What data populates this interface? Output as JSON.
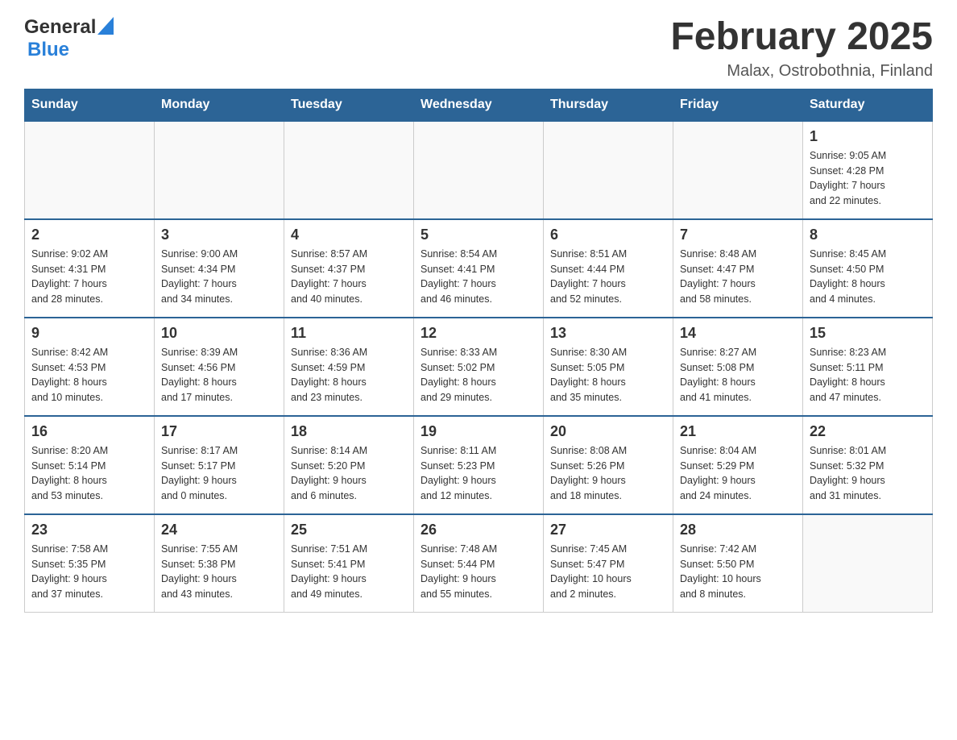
{
  "header": {
    "logo": {
      "general": "General",
      "blue": "Blue",
      "triangle": "▶"
    },
    "title": "February 2025",
    "location": "Malax, Ostrobothnia, Finland"
  },
  "weekdays": [
    "Sunday",
    "Monday",
    "Tuesday",
    "Wednesday",
    "Thursday",
    "Friday",
    "Saturday"
  ],
  "weeks": [
    [
      {
        "day": "",
        "info": ""
      },
      {
        "day": "",
        "info": ""
      },
      {
        "day": "",
        "info": ""
      },
      {
        "day": "",
        "info": ""
      },
      {
        "day": "",
        "info": ""
      },
      {
        "day": "",
        "info": ""
      },
      {
        "day": "1",
        "info": "Sunrise: 9:05 AM\nSunset: 4:28 PM\nDaylight: 7 hours\nand 22 minutes."
      }
    ],
    [
      {
        "day": "2",
        "info": "Sunrise: 9:02 AM\nSunset: 4:31 PM\nDaylight: 7 hours\nand 28 minutes."
      },
      {
        "day": "3",
        "info": "Sunrise: 9:00 AM\nSunset: 4:34 PM\nDaylight: 7 hours\nand 34 minutes."
      },
      {
        "day": "4",
        "info": "Sunrise: 8:57 AM\nSunset: 4:37 PM\nDaylight: 7 hours\nand 40 minutes."
      },
      {
        "day": "5",
        "info": "Sunrise: 8:54 AM\nSunset: 4:41 PM\nDaylight: 7 hours\nand 46 minutes."
      },
      {
        "day": "6",
        "info": "Sunrise: 8:51 AM\nSunset: 4:44 PM\nDaylight: 7 hours\nand 52 minutes."
      },
      {
        "day": "7",
        "info": "Sunrise: 8:48 AM\nSunset: 4:47 PM\nDaylight: 7 hours\nand 58 minutes."
      },
      {
        "day": "8",
        "info": "Sunrise: 8:45 AM\nSunset: 4:50 PM\nDaylight: 8 hours\nand 4 minutes."
      }
    ],
    [
      {
        "day": "9",
        "info": "Sunrise: 8:42 AM\nSunset: 4:53 PM\nDaylight: 8 hours\nand 10 minutes."
      },
      {
        "day": "10",
        "info": "Sunrise: 8:39 AM\nSunset: 4:56 PM\nDaylight: 8 hours\nand 17 minutes."
      },
      {
        "day": "11",
        "info": "Sunrise: 8:36 AM\nSunset: 4:59 PM\nDaylight: 8 hours\nand 23 minutes."
      },
      {
        "day": "12",
        "info": "Sunrise: 8:33 AM\nSunset: 5:02 PM\nDaylight: 8 hours\nand 29 minutes."
      },
      {
        "day": "13",
        "info": "Sunrise: 8:30 AM\nSunset: 5:05 PM\nDaylight: 8 hours\nand 35 minutes."
      },
      {
        "day": "14",
        "info": "Sunrise: 8:27 AM\nSunset: 5:08 PM\nDaylight: 8 hours\nand 41 minutes."
      },
      {
        "day": "15",
        "info": "Sunrise: 8:23 AM\nSunset: 5:11 PM\nDaylight: 8 hours\nand 47 minutes."
      }
    ],
    [
      {
        "day": "16",
        "info": "Sunrise: 8:20 AM\nSunset: 5:14 PM\nDaylight: 8 hours\nand 53 minutes."
      },
      {
        "day": "17",
        "info": "Sunrise: 8:17 AM\nSunset: 5:17 PM\nDaylight: 9 hours\nand 0 minutes."
      },
      {
        "day": "18",
        "info": "Sunrise: 8:14 AM\nSunset: 5:20 PM\nDaylight: 9 hours\nand 6 minutes."
      },
      {
        "day": "19",
        "info": "Sunrise: 8:11 AM\nSunset: 5:23 PM\nDaylight: 9 hours\nand 12 minutes."
      },
      {
        "day": "20",
        "info": "Sunrise: 8:08 AM\nSunset: 5:26 PM\nDaylight: 9 hours\nand 18 minutes."
      },
      {
        "day": "21",
        "info": "Sunrise: 8:04 AM\nSunset: 5:29 PM\nDaylight: 9 hours\nand 24 minutes."
      },
      {
        "day": "22",
        "info": "Sunrise: 8:01 AM\nSunset: 5:32 PM\nDaylight: 9 hours\nand 31 minutes."
      }
    ],
    [
      {
        "day": "23",
        "info": "Sunrise: 7:58 AM\nSunset: 5:35 PM\nDaylight: 9 hours\nand 37 minutes."
      },
      {
        "day": "24",
        "info": "Sunrise: 7:55 AM\nSunset: 5:38 PM\nDaylight: 9 hours\nand 43 minutes."
      },
      {
        "day": "25",
        "info": "Sunrise: 7:51 AM\nSunset: 5:41 PM\nDaylight: 9 hours\nand 49 minutes."
      },
      {
        "day": "26",
        "info": "Sunrise: 7:48 AM\nSunset: 5:44 PM\nDaylight: 9 hours\nand 55 minutes."
      },
      {
        "day": "27",
        "info": "Sunrise: 7:45 AM\nSunset: 5:47 PM\nDaylight: 10 hours\nand 2 minutes."
      },
      {
        "day": "28",
        "info": "Sunrise: 7:42 AM\nSunset: 5:50 PM\nDaylight: 10 hours\nand 8 minutes."
      },
      {
        "day": "",
        "info": ""
      }
    ]
  ]
}
